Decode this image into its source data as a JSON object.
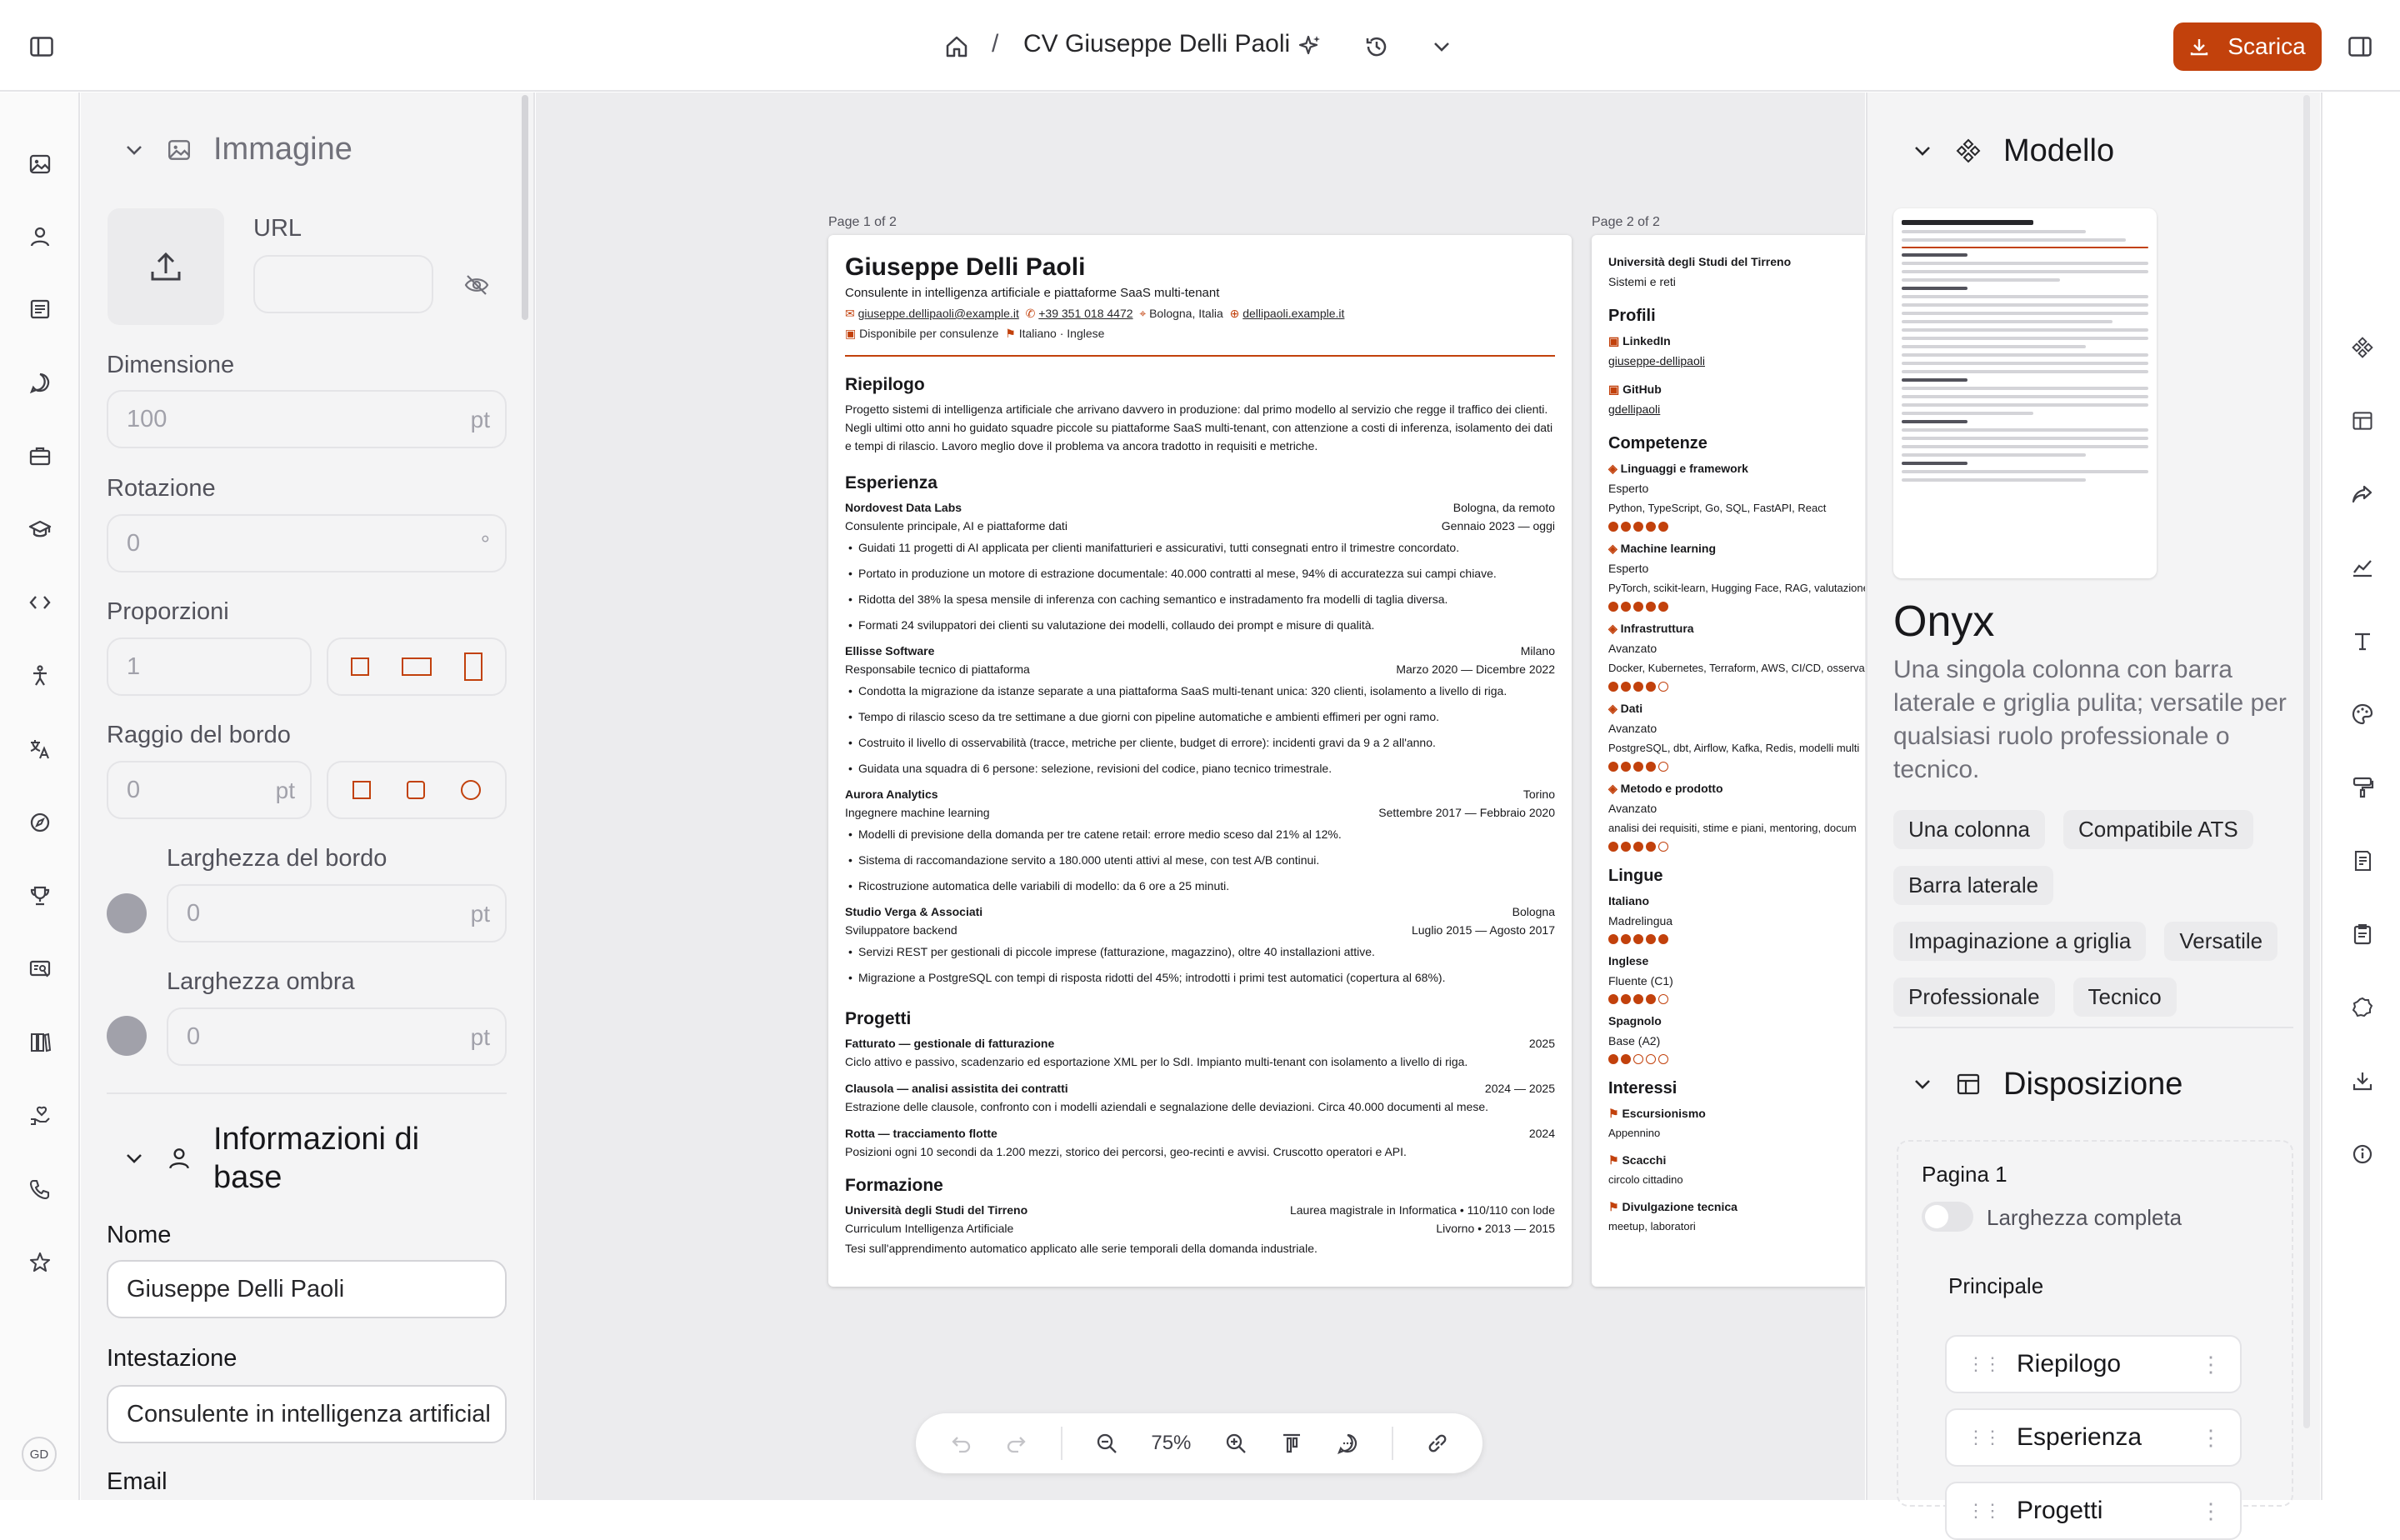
{
  "header": {
    "title": "CV Giuseppe Delli Paoli",
    "separator": "/",
    "download_label": "Scarica"
  },
  "left_rail": {
    "avatar_initials": "GD"
  },
  "image_section": {
    "title": "Immagine",
    "url_label": "URL",
    "size_label": "Dimensione",
    "size_value": "100",
    "size_unit": "pt",
    "rotation_label": "Rotazione",
    "rotation_value": "0",
    "rotation_unit": "°",
    "aspect_label": "Proporzioni",
    "aspect_value": "1",
    "radius_label": "Raggio del bordo",
    "radius_value": "0",
    "radius_unit": "pt",
    "border_width_label": "Larghezza del bordo",
    "border_width_value": "0",
    "border_width_unit": "pt",
    "shadow_width_label": "Larghezza ombra",
    "shadow_width_value": "0",
    "shadow_width_unit": "pt"
  },
  "basics_section": {
    "title": "Informazioni di base",
    "name_label": "Nome",
    "name_value": "Giuseppe Delli Paoli",
    "headline_label": "Intestazione",
    "headline_value": "Consulente in intelligenza artificial",
    "email_label": "Email"
  },
  "canvas": {
    "page1_label": "Page 1 of 2",
    "page2_label": "Page 2 of 2",
    "zoom": "75%"
  },
  "cv": {
    "name": "Giuseppe Delli Paoli",
    "headline": "Consulente in intelligenza artificiale e piattaforme SaaS multi-tenant",
    "email": "giuseppe.dellipaoli@example.it",
    "phone": "+39 351 018 4472",
    "location": "Bologna, Italia",
    "website": "dellipaoli.example.it",
    "availability": "Disponibile per consulenze",
    "languages_line": "Italiano · Inglese",
    "summary_title": "Riepilogo",
    "summary": "Progetto sistemi di intelligenza artificiale che arrivano davvero in produzione: dal primo modello al servizio che regge il traffico dei clienti. Negli ultimi otto anni ho guidato squadre piccole su piattaforme SaaS multi-tenant, con attenzione a costi di inferenza, isolamento dei dati e tempi di rilascio. Lavoro meglio dove il problema va ancora tradotto in requisiti e metriche.",
    "experience_title": "Esperienza",
    "experience": [
      {
        "company": "Nordovest Data Labs",
        "location": "Bologna, da remoto",
        "role": "Consulente principale, AI e piattaforme dati",
        "period": "Gennaio 2023 — oggi",
        "bullets": [
          "Guidati 11 progetti di AI applicata per clienti manifatturieri e assicurativi, tutti consegnati entro il trimestre concordato.",
          "Portato in produzione un motore di estrazione documentale: 40.000 contratti al mese, 94% di accuratezza sui campi chiave.",
          "Ridotta del 38% la spesa mensile di inferenza con caching semantico e instradamento fra modelli di taglia diversa.",
          "Formati 24 sviluppatori dei clienti su valutazione dei modelli, collaudo dei prompt e misure di qualità."
        ]
      },
      {
        "company": "Ellisse Software",
        "location": "Milano",
        "role": "Responsabile tecnico di piattaforma",
        "period": "Marzo 2020 — Dicembre 2022",
        "bullets": [
          "Condotta la migrazione da istanze separate a una piattaforma SaaS multi-tenant unica: 320 clienti, isolamento a livello di riga.",
          "Tempo di rilascio sceso da tre settimane a due giorni con pipeline automatiche e ambienti effimeri per ogni ramo.",
          "Costruito il livello di osservabilità (tracce, metriche per cliente, budget di errore): incidenti gravi da 9 a 2 all'anno.",
          "Guidata una squadra di 6 persone: selezione, revisioni del codice, piano tecnico trimestrale."
        ]
      },
      {
        "company": "Aurora Analytics",
        "location": "Torino",
        "role": "Ingegnere machine learning",
        "period": "Settembre 2017 — Febbraio 2020",
        "bullets": [
          "Modelli di previsione della domanda per tre catene retail: errore medio sceso dal 21% al 12%.",
          "Sistema di raccomandazione servito a 180.000 utenti attivi al mese, con test A/B continui.",
          "Ricostruzione automatica delle variabili di modello: da 6 ore a 25 minuti."
        ]
      },
      {
        "company": "Studio Verga & Associati",
        "location": "Bologna",
        "role": "Sviluppatore backend",
        "period": "Luglio 2015 — Agosto 2017",
        "bullets": [
          "Servizi REST per gestionali di piccole imprese (fatturazione, magazzino), oltre 40 installazioni attive.",
          "Migrazione a PostgreSQL con tempi di risposta ridotti del 45%; introdotti i primi test automatici (copertura al 68%)."
        ]
      }
    ],
    "projects_title": "Progetti",
    "projects": [
      {
        "name": "Fatturato — gestionale di fatturazione",
        "year": "2025",
        "desc": "Ciclo attivo e passivo, scadenzario ed esportazione XML per lo SdI. Impianto multi-tenant con isolamento a livello di riga."
      },
      {
        "name": "Clausola — analisi assistita dei contratti",
        "year": "2024 — 2025",
        "desc": "Estrazione delle clausole, confronto con i modelli aziendali e segnalazione delle deviazioni. Circa 40.000 documenti al mese."
      },
      {
        "name": "Rotta — tracciamento flotte",
        "year": "2024",
        "desc": "Posizioni ogni 10 secondi da 1.200 mezzi, storico dei percorsi, geo-recinti e avvisi. Cruscotto operatori e API."
      }
    ],
    "education_title": "Formazione",
    "education": {
      "school": "Università degli Studi del Tirreno",
      "degree": "Laurea magistrale in Informatica • 110/110 con lode",
      "program": "Curriculum Intelligenza Artificiale",
      "place_period": "Livorno • 2013 — 2015",
      "thesis": "Tesi sull'apprendimento automatico applicato alle serie temporali della domanda industriale."
    },
    "page2": {
      "school": "Università degli Studi del Tirreno",
      "school_sub": "Sistemi e reti",
      "profiles_title": "Profili",
      "profiles": [
        {
          "network": "LinkedIn",
          "handle": "giuseppe-dellipaoli"
        },
        {
          "network": "GitHub",
          "handle": "gdellipaoli"
        }
      ],
      "skills_title": "Competenze",
      "skills": [
        {
          "name": "Linguaggi e framework",
          "level": "Esperto",
          "keywords": "Python, TypeScript, Go, SQL, FastAPI, React",
          "rating": 5
        },
        {
          "name": "Machine learning",
          "level": "Esperto",
          "keywords": "PyTorch, scikit-learn, Hugging Face, RAG, valutazione",
          "rating": 5
        },
        {
          "name": "Infrastruttura",
          "level": "Avanzato",
          "keywords": "Docker, Kubernetes, Terraform, AWS, CI/CD, osservabilità",
          "rating": 4
        },
        {
          "name": "Dati",
          "level": "Avanzato",
          "keywords": "PostgreSQL, dbt, Airflow, Kafka, Redis, modelli multi",
          "rating": 4
        },
        {
          "name": "Metodo e prodotto",
          "level": "Avanzato",
          "keywords": "analisi dei requisiti, stime e piani, mentoring, docum",
          "rating": 4
        }
      ],
      "languages_title": "Lingue",
      "languages": [
        {
          "name": "Italiano",
          "level": "Madrelingua",
          "rating": 5
        },
        {
          "name": "Inglese",
          "level": "Fluente (C1)",
          "rating": 4
        },
        {
          "name": "Spagnolo",
          "level": "Base (A2)",
          "rating": 2
        }
      ],
      "interests_title": "Interessi",
      "interests": [
        {
          "name": "Escursionismo",
          "desc": "Appennino"
        },
        {
          "name": "Scacchi",
          "desc": "circolo cittadino"
        },
        {
          "name": "Divulgazione tecnica",
          "desc": "meetup, laboratori"
        }
      ]
    }
  },
  "right_panel": {
    "template_section_title": "Modello",
    "template_name": "Onyx",
    "template_desc": "Una singola colonna con barra laterale e griglia pulita; versatile per qualsiasi ruolo professionale o tecnico.",
    "tags": [
      "Una colonna",
      "Compatibile ATS",
      "Barra laterale",
      "Impaginazione a griglia",
      "Versatile",
      "Professionale",
      "Tecnico"
    ],
    "layout_section_title": "Disposizione",
    "page_label": "Pagina 1",
    "full_width_label": "Larghezza completa",
    "main_label": "Principale",
    "main_items": [
      "Riepilogo",
      "Esperienza",
      "Progetti"
    ]
  },
  "colors": {
    "accent": "#c2410c"
  }
}
